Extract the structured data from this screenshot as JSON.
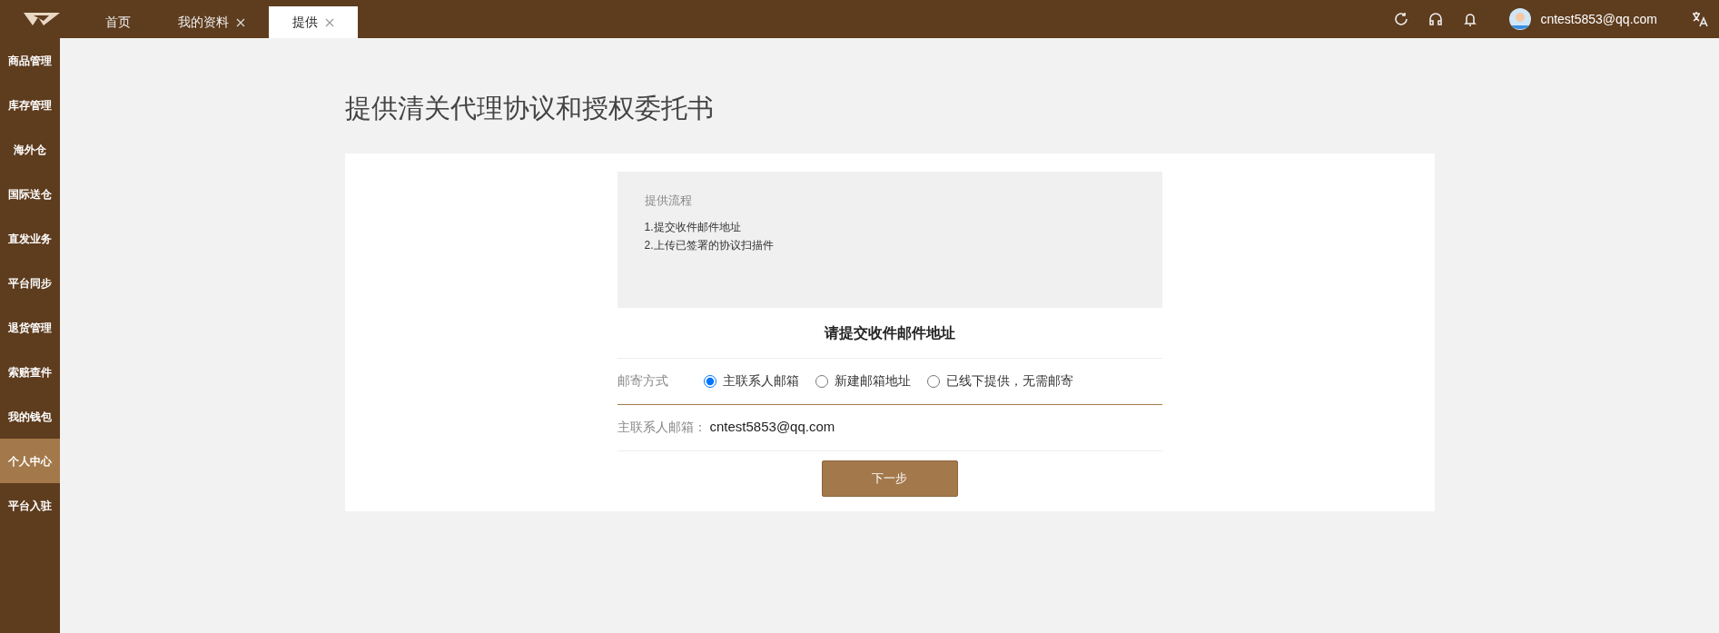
{
  "tabs": [
    {
      "label": "首页",
      "selected": false,
      "closable": false
    },
    {
      "label": "我的资料",
      "selected": false,
      "closable": true
    },
    {
      "label": "提供",
      "selected": true,
      "closable": true
    }
  ],
  "user": {
    "email": "cntest5853@qq.com"
  },
  "sidebar": {
    "items": [
      {
        "label": "商品管理",
        "selected": false
      },
      {
        "label": "库存管理",
        "selected": false
      },
      {
        "label": "海外仓",
        "selected": false
      },
      {
        "label": "国际送仓",
        "selected": false
      },
      {
        "label": "直发业务",
        "selected": false
      },
      {
        "label": "平台同步",
        "selected": false
      },
      {
        "label": "退货管理",
        "selected": false
      },
      {
        "label": "索赔查件",
        "selected": false
      },
      {
        "label": "我的钱包",
        "selected": false
      },
      {
        "label": "个人中心",
        "selected": true
      },
      {
        "label": "平台入驻",
        "selected": false
      }
    ]
  },
  "page_title": "提供清关代理协议和授权委托书",
  "process": {
    "title": "提供流程",
    "steps": [
      "1.提交收件邮件地址",
      "2.上传已签署的协议扫描件"
    ]
  },
  "form": {
    "heading": "请提交收件邮件地址",
    "mail_method": {
      "label": "邮寄方式",
      "options": [
        {
          "label": "主联系人邮箱",
          "selected": true
        },
        {
          "label": "新建邮箱地址",
          "selected": false
        },
        {
          "label": "已线下提供，无需邮寄",
          "selected": false
        }
      ]
    },
    "email": {
      "label": "主联系人邮箱：",
      "value": "cntest5853@qq.com"
    },
    "next_button": "下一步"
  }
}
